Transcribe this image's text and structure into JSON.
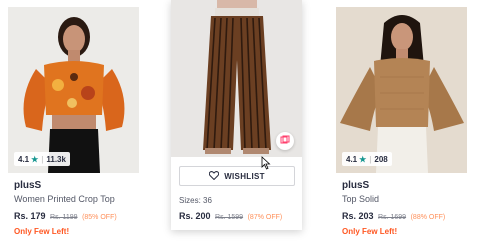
{
  "products": [
    {
      "rating": "4.1",
      "rating_count": "11.3k",
      "brand": "plusS",
      "title": "Women Printed Crop Top",
      "price": "Rs. 179",
      "mrp": "Rs. 1199",
      "discount": "(85% OFF)",
      "stock_note": "Only Few Left!"
    },
    {
      "wishlist_label": "WISHLIST",
      "sizes": "Sizes: 36",
      "price": "Rs. 200",
      "mrp": "Rs. 1599",
      "discount": "(87% OFF)"
    },
    {
      "rating": "4.1",
      "rating_count": "208",
      "brand": "plusS",
      "title": "Top Solid",
      "price": "Rs. 203",
      "mrp": "Rs. 1699",
      "discount": "(88% OFF)",
      "stock_note": "Only Few Left!"
    }
  ],
  "colors": {
    "rating_star": "#14958f",
    "discount": "#ff905a",
    "few_left": "#ff5722"
  }
}
